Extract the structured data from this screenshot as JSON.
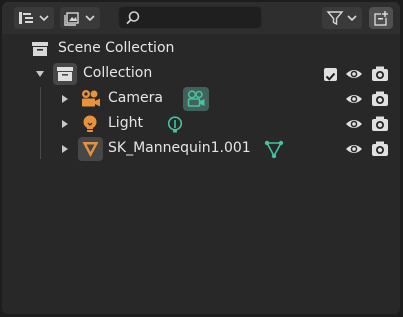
{
  "toolbar": {
    "display_mode_icon": "outliner-display-mode-icon",
    "view_layer_icon": "view-layer-icon",
    "search": {
      "placeholder": "",
      "value": ""
    },
    "filter_icon": "filter-icon",
    "new_collection_icon": "new-collection-icon"
  },
  "scene": {
    "label": "Scene Collection"
  },
  "tree": [
    {
      "label": "Collection",
      "expanded": true,
      "checked": true,
      "children": [
        {
          "label": "Camera",
          "type": "camera"
        },
        {
          "label": "Light",
          "type": "light"
        },
        {
          "label": "SK_Mannequin1.001",
          "type": "mesh"
        }
      ]
    }
  ],
  "colors": {
    "background": "#282828",
    "header": "#2e2e2e",
    "object_orange": "#e8923b",
    "data_green": "#43c3a1",
    "text": "#e6e6e6"
  }
}
